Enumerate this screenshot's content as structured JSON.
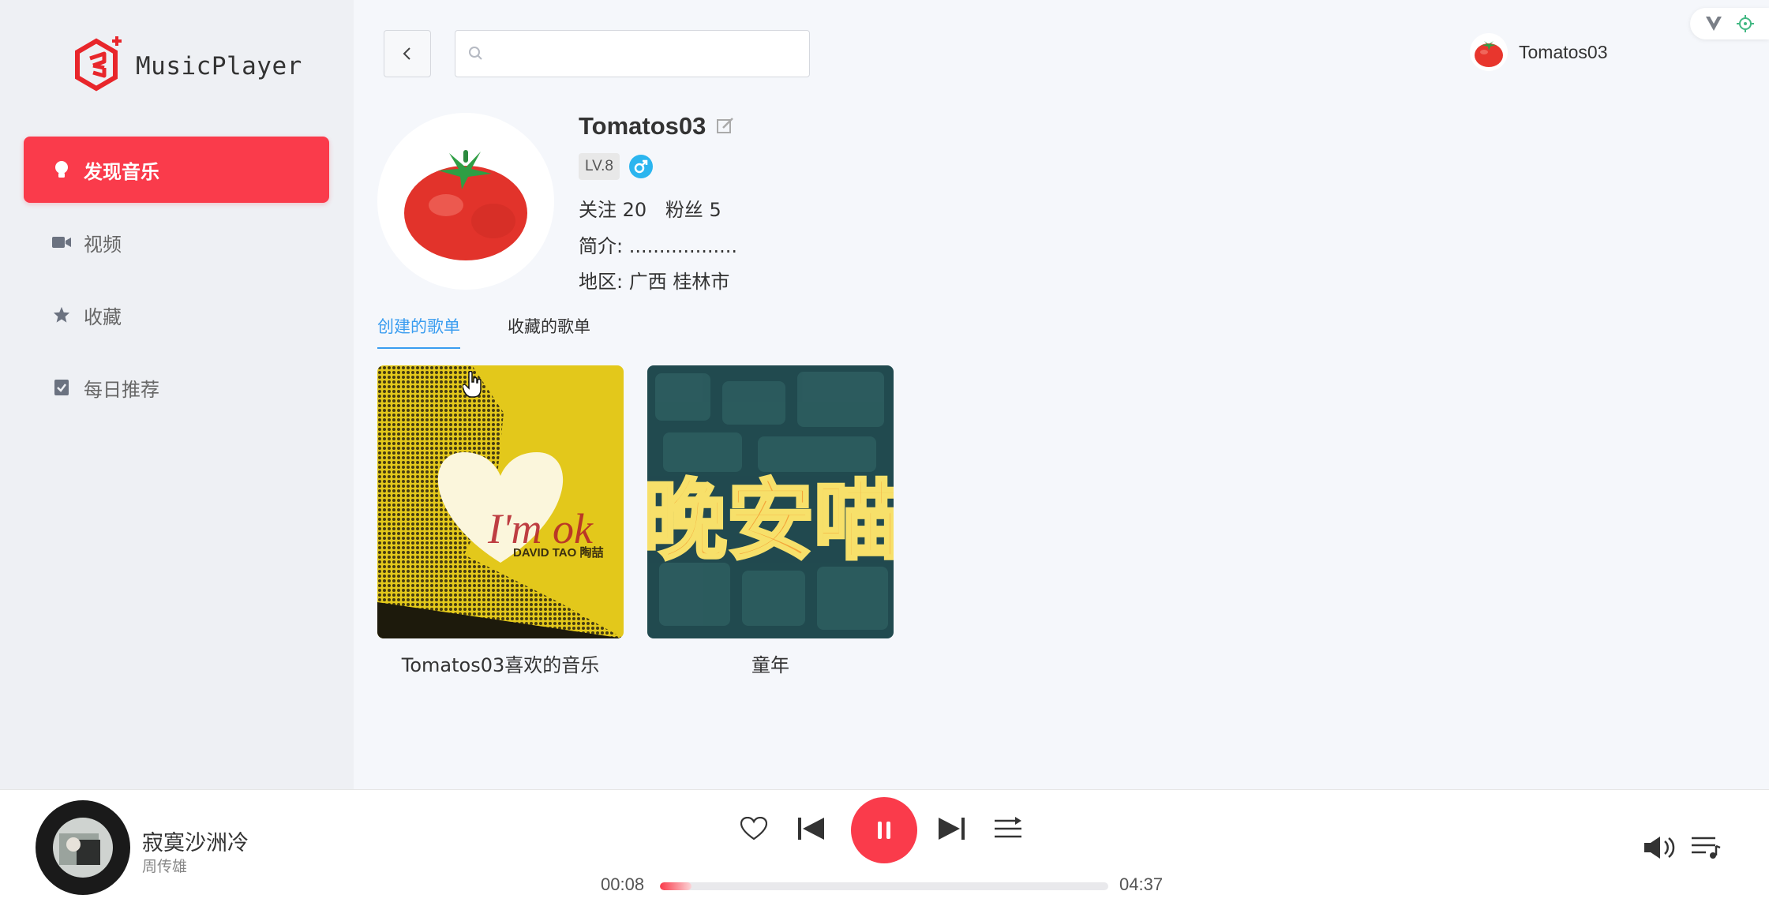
{
  "app": {
    "name": "MusicPlayer"
  },
  "sidebar": {
    "items": [
      {
        "label": "发现音乐",
        "icon": "bulb-icon",
        "active": true
      },
      {
        "label": "视频",
        "icon": "video-icon",
        "active": false
      },
      {
        "label": "收藏",
        "icon": "star-icon",
        "active": false
      },
      {
        "label": "每日推荐",
        "icon": "calendar-check-icon",
        "active": false
      }
    ]
  },
  "header": {
    "search": {
      "value": "",
      "placeholder": ""
    },
    "user": {
      "name": "Tomatos03"
    }
  },
  "profile": {
    "name": "Tomatos03",
    "level": "LV.8",
    "gender": "male",
    "follow_label": "关注 20",
    "fans_label": "粉丝 5",
    "intro_label": "简介:",
    "intro_value": "..................",
    "region_label": "地区:",
    "region_value": "广西 桂林市"
  },
  "tabs": [
    {
      "label": "创建的歌单",
      "active": true
    },
    {
      "label": "收藏的歌单",
      "active": false
    }
  ],
  "playlists": [
    {
      "name": "Tomatos03喜欢的音乐",
      "cover_text_1": "I'm ok",
      "cover_text_2": "DAVID TAO 陶喆"
    },
    {
      "name": "童年",
      "cover_text_1": "晚安喵"
    }
  ],
  "player": {
    "song": "寂寞沙洲冷",
    "artist": "周传雄",
    "current_time": "00:08",
    "total_time": "04:37",
    "progress": 0.07,
    "state": "playing"
  },
  "colors": {
    "accent": "#fa3b4b",
    "tab_active": "#3a9df0",
    "gender_badge": "#2bb5ef"
  }
}
